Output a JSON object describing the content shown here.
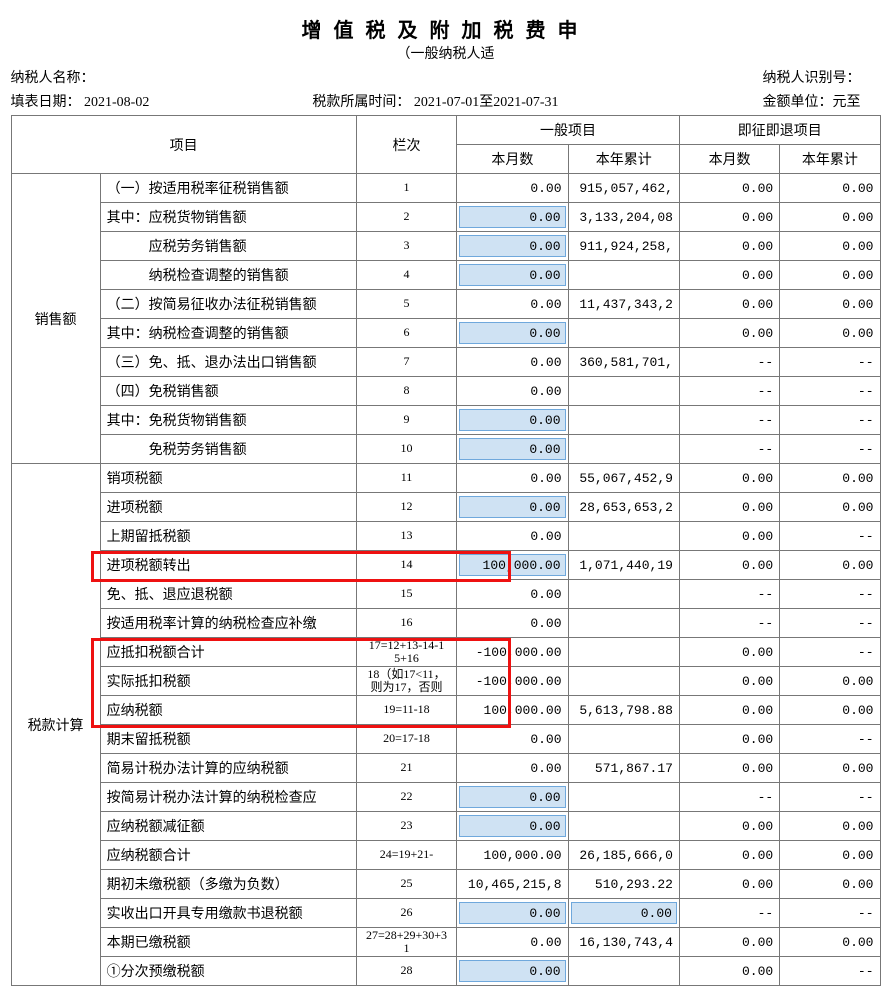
{
  "header": {
    "title": "增值税及附加税费申",
    "subtitle": "（一般纳税人适",
    "taxpayer_name_label": "纳税人名称：",
    "taxpayer_id_label": "纳税人识别号：",
    "fill_date_label": "填表日期：",
    "fill_date": "2021-08-02",
    "period_label": "税款所属时间：",
    "period": "2021-07-01至2021-07-31",
    "unit_label": "金额单位：元至"
  },
  "thead": {
    "item": "项目",
    "col_no": "栏次",
    "general": "一般项目",
    "refund": "即征即退项目",
    "this_month": "本月数",
    "this_year": "本年累计"
  },
  "groups": [
    {
      "name": "销售额",
      "rowspan": 10
    },
    {
      "name": "税款计算",
      "rowspan": 18
    }
  ],
  "rows": [
    {
      "item": "（一）按适用税率征税销售额",
      "no": "1",
      "gm": "0.00",
      "gm_edit": false,
      "gy": "915,057,462,",
      "rm": "0.00",
      "ry": "0.00"
    },
    {
      "item": "其中：应税货物销售额",
      "no": "2",
      "gm": "0.00",
      "gm_edit": true,
      "gy": "3,133,204,08",
      "rm": "0.00",
      "ry": "0.00"
    },
    {
      "item": "　　　应税劳务销售额",
      "no": "3",
      "gm": "0.00",
      "gm_edit": true,
      "gy": "911,924,258,",
      "rm": "0.00",
      "ry": "0.00"
    },
    {
      "item": "　　　纳税检查调整的销售额",
      "no": "4",
      "gm": "0.00",
      "gm_edit": true,
      "gy": "",
      "rm": "0.00",
      "ry": "0.00"
    },
    {
      "item": "（二）按简易征收办法征税销售额",
      "no": "5",
      "gm": "0.00",
      "gm_edit": false,
      "gy": "11,437,343,2",
      "rm": "0.00",
      "ry": "0.00"
    },
    {
      "item": "其中：纳税检查调整的销售额",
      "no": "6",
      "gm": "0.00",
      "gm_edit": true,
      "gy": "",
      "rm": "0.00",
      "ry": "0.00"
    },
    {
      "item": "（三）免、抵、退办法出口销售额",
      "no": "7",
      "gm": "0.00",
      "gm_edit": false,
      "gy": "360,581,701,",
      "rm": "--",
      "ry": "--"
    },
    {
      "item": "（四）免税销售额",
      "no": "8",
      "gm": "0.00",
      "gm_edit": false,
      "gy": "",
      "rm": "--",
      "ry": "--"
    },
    {
      "item": "其中：免税货物销售额",
      "no": "9",
      "gm": "0.00",
      "gm_edit": true,
      "gy": "",
      "rm": "--",
      "ry": "--"
    },
    {
      "item": "　　　免税劳务销售额",
      "no": "10",
      "gm": "0.00",
      "gm_edit": true,
      "gy": "",
      "rm": "--",
      "ry": "--"
    },
    {
      "item": "销项税额",
      "no": "11",
      "gm": "0.00",
      "gm_edit": false,
      "gy": "55,067,452,9",
      "rm": "0.00",
      "ry": "0.00"
    },
    {
      "item": "进项税额",
      "no": "12",
      "gm": "0.00",
      "gm_edit": true,
      "gy": "28,653,653,2",
      "rm": "0.00",
      "ry": "0.00"
    },
    {
      "item": "上期留抵税额",
      "no": "13",
      "gm": "0.00",
      "gm_edit": false,
      "gy": "",
      "rm": "0.00",
      "ry": "--"
    },
    {
      "item": "进项税额转出",
      "no": "14",
      "gm": "100,000.00",
      "gm_edit": true,
      "gy": "1,071,440,19",
      "rm": "0.00",
      "ry": "0.00"
    },
    {
      "item": "免、抵、退应退税额",
      "no": "15",
      "gm": "0.00",
      "gm_edit": false,
      "gy": "",
      "rm": "--",
      "ry": "--"
    },
    {
      "item": "按适用税率计算的纳税检查应补缴",
      "no": "16",
      "gm": "0.00",
      "gm_edit": false,
      "gy": "",
      "rm": "--",
      "ry": "--"
    },
    {
      "item": "应抵扣税额合计",
      "no": "17=12+13-14-1\n5+16",
      "gm": "-100,000.00",
      "gm_edit": false,
      "gy": "",
      "rm": "0.00",
      "ry": "--"
    },
    {
      "item": "实际抵扣税额",
      "no": "18（如17<11，\n则为17，否则",
      "gm": "-100,000.00",
      "gm_edit": false,
      "gy": "",
      "rm": "0.00",
      "ry": "0.00"
    },
    {
      "item": "应纳税额",
      "no": "19=11-18",
      "gm": "100,000.00",
      "gm_edit": false,
      "gy": "5,613,798.88",
      "rm": "0.00",
      "ry": "0.00"
    },
    {
      "item": "期末留抵税额",
      "no": "20=17-18",
      "gm": "0.00",
      "gm_edit": false,
      "gy": "",
      "rm": "0.00",
      "ry": "--"
    },
    {
      "item": "简易计税办法计算的应纳税额",
      "no": "21",
      "gm": "0.00",
      "gm_edit": false,
      "gy": "571,867.17",
      "rm": "0.00",
      "ry": "0.00"
    },
    {
      "item": "按简易计税办法计算的纳税检查应",
      "no": "22",
      "gm": "0.00",
      "gm_edit": true,
      "gy": "",
      "rm": "--",
      "ry": "--"
    },
    {
      "item": "应纳税额减征额",
      "no": "23",
      "gm": "0.00",
      "gm_edit": true,
      "gy": "",
      "rm": "0.00",
      "ry": "0.00"
    },
    {
      "item": "应纳税额合计",
      "no": "24=19+21-",
      "gm": "100,000.00",
      "gm_edit": false,
      "gy": "26,185,666,0",
      "rm": "0.00",
      "ry": "0.00"
    },
    {
      "item": "期初未缴税额（多缴为负数）",
      "no": "25",
      "gm": "10,465,215,8",
      "gm_edit": false,
      "gy": "510,293.22",
      "rm": "0.00",
      "ry": "0.00"
    },
    {
      "item": "实收出口开具专用缴款书退税额",
      "no": "26",
      "gm": "0.00",
      "gm_edit": true,
      "gy": "0.00",
      "gy_edit": true,
      "rm": "--",
      "ry": "--"
    },
    {
      "item": "本期已缴税额",
      "no": "27=28+29+30+3\n1",
      "gm": "0.00",
      "gm_edit": false,
      "gy": "16,130,743,4",
      "rm": "0.00",
      "ry": "0.00"
    },
    {
      "item": "①分次预缴税额",
      "no": "28",
      "gm": "0.00",
      "gm_edit": true,
      "gy": "",
      "rm": "0.00",
      "ry": "--"
    }
  ]
}
